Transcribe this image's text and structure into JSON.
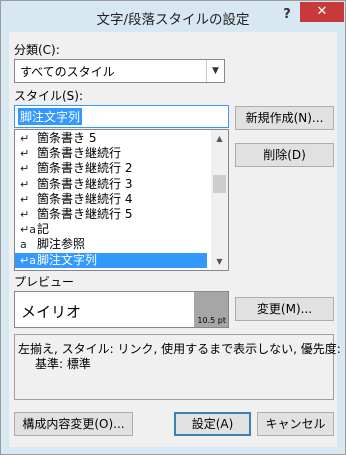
{
  "window": {
    "title": "文字/段落スタイルの設定",
    "help_label": "?",
    "close_label": "✕"
  },
  "category": {
    "label": "分類(C):",
    "value": "すべてのスタイル"
  },
  "style": {
    "label": "スタイル(S):",
    "value": "脚注文字列"
  },
  "style_list": [
    {
      "icon": "paragraph-icon",
      "glyph": "↵",
      "label": "箇条書き 5"
    },
    {
      "icon": "paragraph-icon",
      "glyph": "↵",
      "label": "箇条書き継続行"
    },
    {
      "icon": "paragraph-icon",
      "glyph": "↵",
      "label": "箇条書き継続行 2"
    },
    {
      "icon": "paragraph-icon",
      "glyph": "↵",
      "label": "箇条書き継続行 3"
    },
    {
      "icon": "paragraph-icon",
      "glyph": "↵",
      "label": "箇条書き継続行 4"
    },
    {
      "icon": "paragraph-icon",
      "glyph": "↵",
      "label": "箇条書き継続行 5"
    },
    {
      "icon": "linked-style-icon",
      "glyph": "↵a",
      "label": "記"
    },
    {
      "icon": "character-icon",
      "glyph": "a",
      "label": "脚注参照"
    },
    {
      "icon": "linked-style-icon",
      "glyph": "↵a",
      "label": "脚注文字列",
      "selected": true
    }
  ],
  "buttons": {
    "new": "新規作成(N)...",
    "delete": "削除(D)",
    "modify": "変更(M)...",
    "organize": "構成内容変更(O)...",
    "set": "設定(A)",
    "cancel": "キャンセル"
  },
  "preview": {
    "label": "プレビュー",
    "font_name": "メイリオ",
    "size": "10.5 pt"
  },
  "description": {
    "line1": "左揃え, スタイル: リンク, 使用するまで表示しない, 優先度: 100",
    "line2": "基準: 標準"
  }
}
